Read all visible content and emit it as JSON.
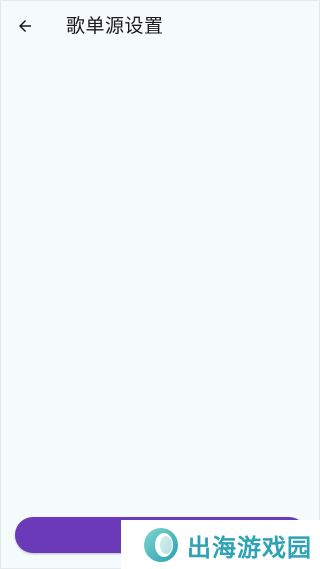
{
  "header": {
    "title": "歌单源设置",
    "back_icon": "arrow-left-icon"
  },
  "footer": {
    "primary_button_label": ""
  },
  "watermark": {
    "text": "出海游戏园",
    "logo_icon": "ring-logo-icon"
  },
  "colors": {
    "background": "#f5fafb",
    "accent": "#6a3ab8",
    "watermark_text": "#2fa3b3"
  }
}
